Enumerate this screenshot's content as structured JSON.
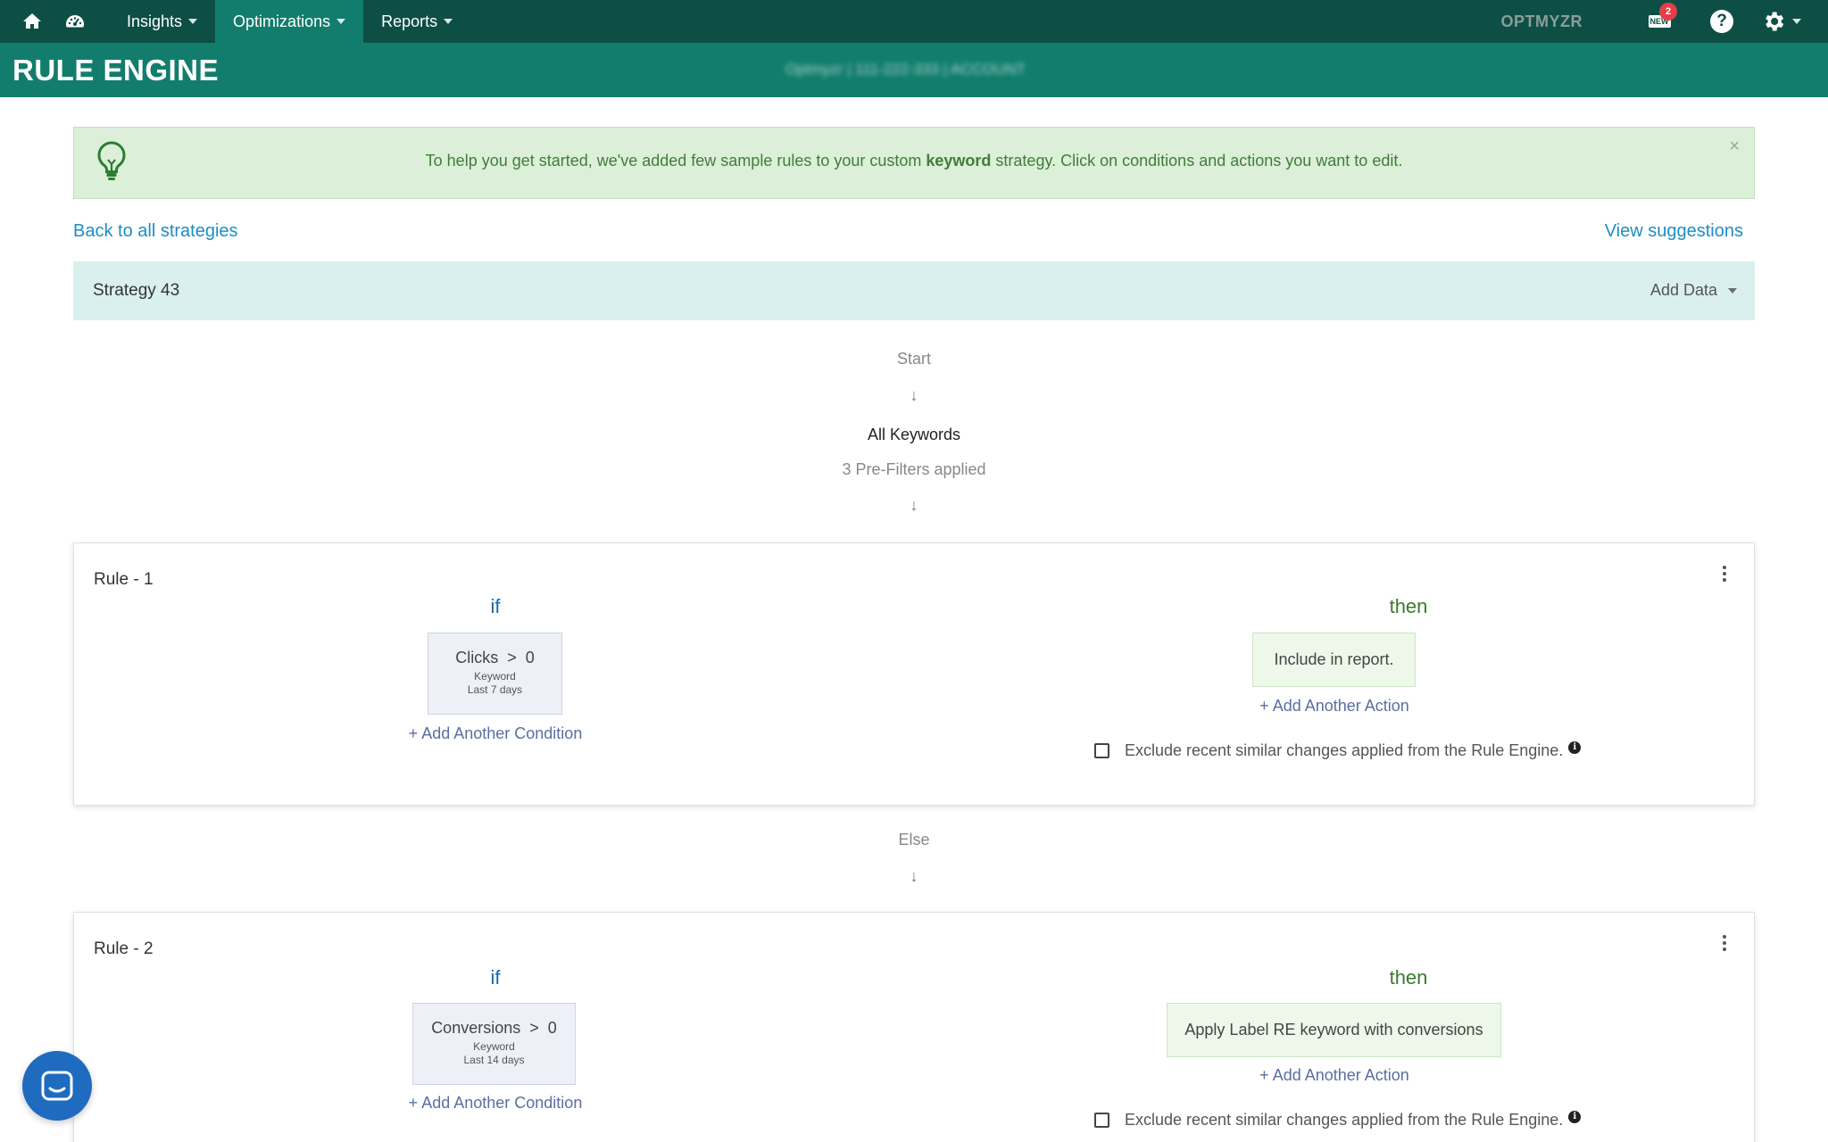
{
  "nav": {
    "items": [
      {
        "label": "Insights"
      },
      {
        "label": "Optimizations"
      },
      {
        "label": "Reports"
      }
    ],
    "brand": "OPTMYZR",
    "news_tag": "NEW",
    "news_badge": "2",
    "help": "?",
    "accent_color": "#0d4f45"
  },
  "header": {
    "title": "RULE ENGINE",
    "account": "Optmyzr | 111-222-333 | ACCOUNT"
  },
  "banner": {
    "text_before": "To help you get started, we've added few sample rules to your custom ",
    "text_bold": "keyword",
    "text_after": " strategy. Click on conditions and actions you want to edit.",
    "close": "×"
  },
  "links": {
    "back": "Back to all strategies",
    "suggestions": "View suggestions"
  },
  "strategy": {
    "name": "Strategy 43",
    "add_data": "Add Data"
  },
  "flow": {
    "start": "Start",
    "arrow": "↓",
    "scope": "All Keywords",
    "prefilters": "3 Pre-Filters applied",
    "else": "Else"
  },
  "rules": [
    {
      "title": "Rule - 1",
      "if_label": "if",
      "then_label": "then",
      "condition": {
        "metric": "Clicks",
        "operator": ">",
        "value": "0",
        "level": "Keyword",
        "range": "Last 7 days"
      },
      "action": "Include in report.",
      "add_condition": "+ Add Another Condition",
      "add_action": "+ Add Another Action",
      "exclude_text": "Exclude recent similar changes applied from the Rule Engine."
    },
    {
      "title": "Rule - 2",
      "if_label": "if",
      "then_label": "then",
      "condition": {
        "metric": "Conversions",
        "operator": ">",
        "value": "0",
        "level": "Keyword",
        "range": "Last 14 days"
      },
      "action": "Apply Label RE keyword with conversions",
      "add_condition": "+ Add Another Condition",
      "add_action": "+ Add Another Action",
      "exclude_text": "Exclude recent similar changes applied from the Rule Engine."
    }
  ],
  "info_icon": "i"
}
